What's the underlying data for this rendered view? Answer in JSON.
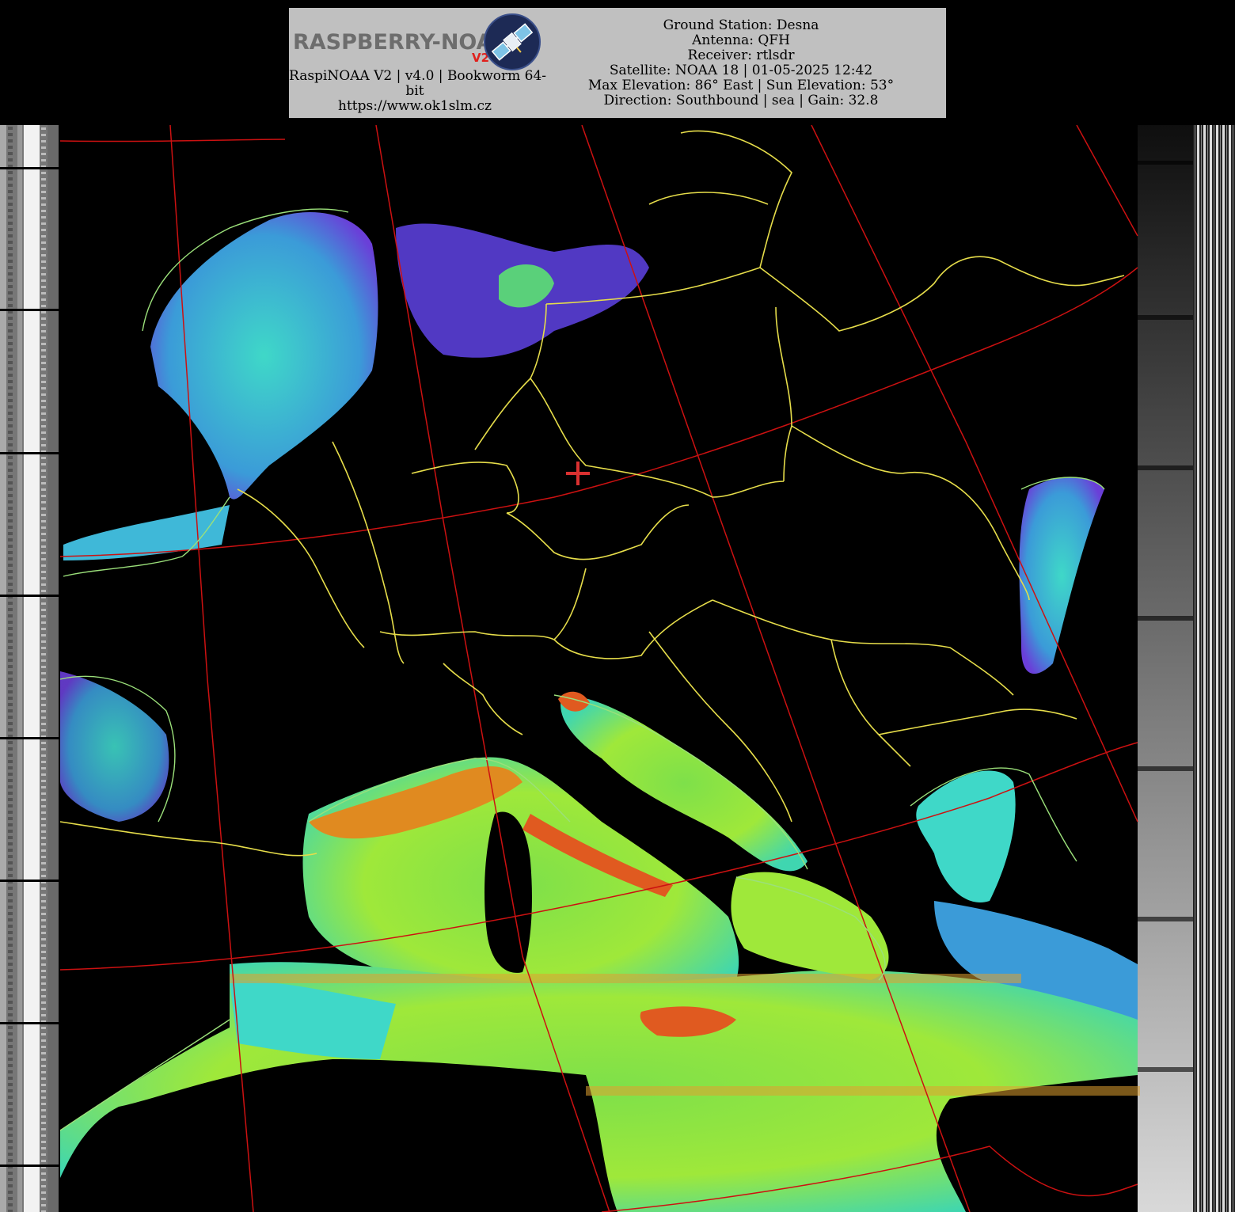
{
  "header": {
    "logo": {
      "text": "RASPBERRY-NOAA",
      "version_badge": "V2",
      "icon": "satellite-icon"
    },
    "left_lines": [
      "RaspiNOAA V2 | v4.0 | Bookworm 64-",
      "bit",
      "https://www.ok1slm.cz"
    ],
    "info_lines": [
      "Ground Station: Desna",
      "Antenna: QFH",
      "Receiver: rtlsdr",
      "Satellite: NOAA 18 | 01-05-2025 12:42",
      "Max Elevation: 86° East | Sun Elevation: 53°",
      "Direction: Southbound | sea | Gain: 32.8"
    ]
  },
  "image": {
    "type": "NOAA APT sea surface temperature composite",
    "region": "Europe / Mediterranean",
    "colors": {
      "background": "#000000",
      "header_bg": "#c0c0c0",
      "graticule": "#cc1111",
      "borders": "#e6dd4a",
      "coastline": "#9be07a",
      "station_marker": "#d93030"
    }
  }
}
